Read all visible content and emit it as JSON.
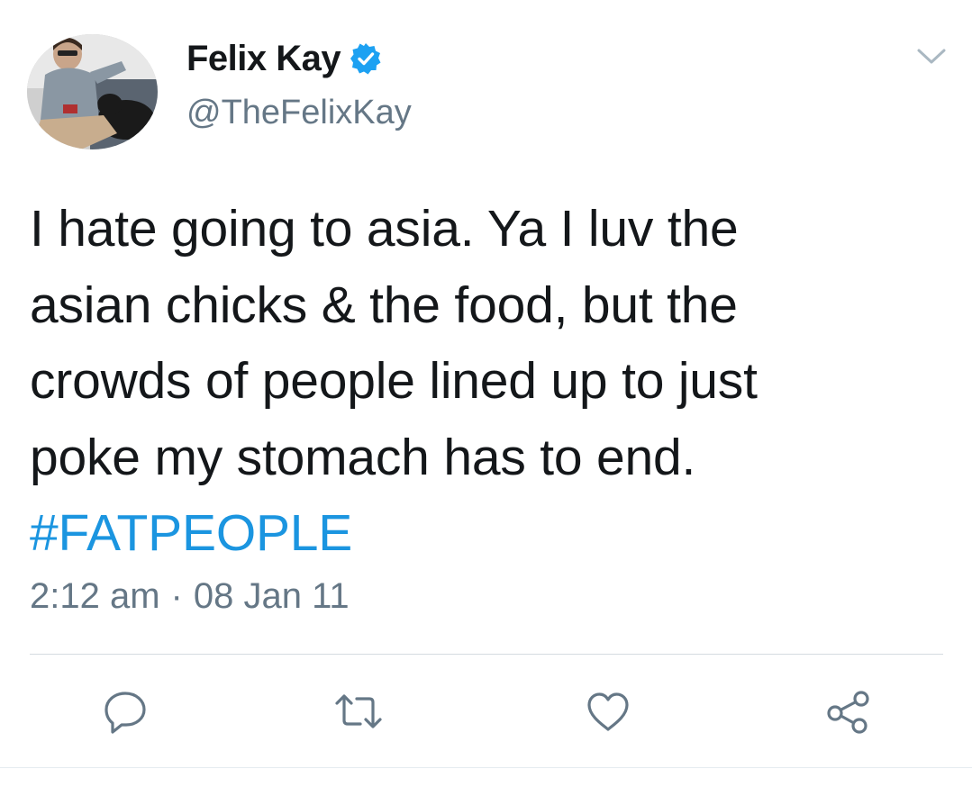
{
  "user": {
    "display_name": "Felix Kay",
    "handle": "@TheFelixKay",
    "verified": true
  },
  "tweet": {
    "lines": [
      "I hate going to asia. Ya I luv the",
      "asian chicks & the food, but the",
      "crowds of people lined up to just",
      "poke my stomach has to end."
    ],
    "hashtag": "#FATPEOPLE",
    "time": "2:12 am",
    "separator": "·",
    "date": "08 Jan 11"
  },
  "actions": [
    {
      "icon": "reply-icon"
    },
    {
      "icon": "retweet-icon"
    },
    {
      "icon": "like-icon"
    },
    {
      "icon": "share-icon"
    }
  ],
  "colors": {
    "text": "#14171a",
    "secondary": "#657786",
    "link": "#1b95e0",
    "verified": "#1da1f2",
    "divider": "#d4dbe0"
  }
}
